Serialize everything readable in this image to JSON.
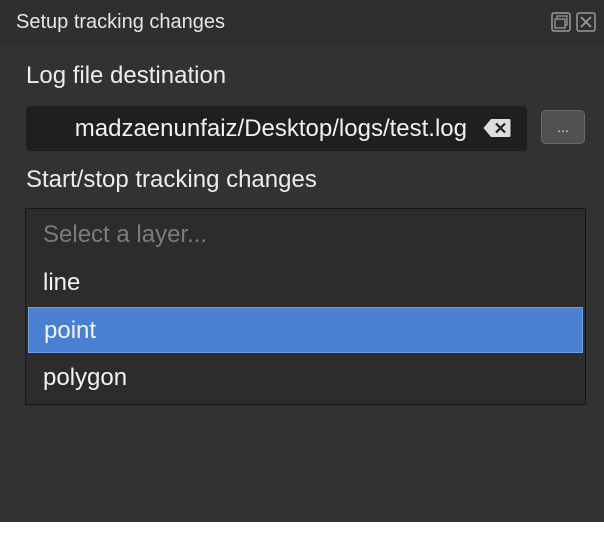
{
  "window": {
    "title": "Setup tracking changes",
    "float_icon": "float-icon",
    "close_icon": "close-icon"
  },
  "log_file": {
    "label": "Log file destination",
    "path_value": "madzaenunfaiz/Desktop/logs/test.log",
    "clear_icon": "clear-input-icon",
    "browse_label": "..."
  },
  "tracking": {
    "label": "Start/stop tracking changes",
    "layer_select": {
      "placeholder": "Select a layer...",
      "options": [
        "line",
        "point",
        "polygon"
      ],
      "highlighted": "point"
    }
  },
  "colors": {
    "panel_bg": "#323232",
    "field_bg": "#1f1f1f",
    "highlight": "#4a7fd1"
  }
}
